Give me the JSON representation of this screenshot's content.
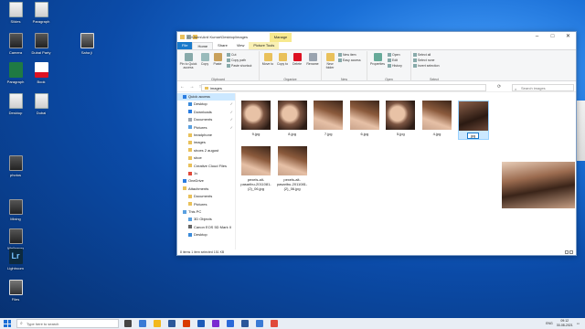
{
  "desktop": {
    "icons": [
      {
        "label": "Sildes",
        "kind": "doc"
      },
      {
        "label": "Paragraph",
        "kind": "doc"
      },
      {
        "label": "Camera",
        "kind": "exe"
      },
      {
        "label": "Dubai Party",
        "kind": "exe"
      },
      {
        "label": "Saha ji",
        "kind": "photo"
      },
      {
        "label": "Paragraph",
        "kind": "xls"
      },
      {
        "label": "Book",
        "kind": "pdf"
      },
      {
        "label": "Desktop",
        "kind": "doc"
      },
      {
        "label": "Dubai",
        "kind": "doc"
      },
      {
        "label": "photos",
        "kind": "exe"
      },
      {
        "label": "Mixing",
        "kind": "exe"
      },
      {
        "label": "Wallpaper",
        "kind": "exe"
      },
      {
        "label": "Lightroom",
        "kind": "lr"
      },
      {
        "label": "Files",
        "kind": "photo"
      }
    ]
  },
  "explorer": {
    "title": "C:\\Users\\Anil Kumar\\Desktop\\images",
    "manage_label": "Manage",
    "window_buttons": [
      "–",
      "□",
      "✕"
    ],
    "tabs": [
      "File",
      "Home",
      "Share",
      "View",
      "Picture Tools"
    ],
    "ribbon": {
      "clipboard": {
        "name": "Clipboard",
        "pin": "Pin to Quick access",
        "copy": "Copy",
        "paste": "Paste",
        "cut": "Cut",
        "copy_path": "Copy path",
        "paste_shortcut": "Paste shortcut"
      },
      "organize": {
        "name": "Organize",
        "move_to": "Move to",
        "copy_to": "Copy to",
        "delete": "Delete",
        "rename": "Rename"
      },
      "new": {
        "name": "New",
        "new_folder": "New folder",
        "new_item": "New item",
        "easy_access": "Easy access"
      },
      "open": {
        "name": "Open",
        "properties": "Properties",
        "open": "Open",
        "edit": "Edit",
        "history": "History"
      },
      "select": {
        "name": "Select",
        "select_all": "Select all",
        "select_none": "Select none",
        "invert": "Invert selection"
      }
    },
    "address": {
      "nav": "←  →  ↑",
      "path": "images",
      "search_placeholder": "Search images"
    },
    "nav_items": [
      {
        "label": "Quick access",
        "pinned": false,
        "selected": true,
        "color": "#2a7de1"
      },
      {
        "label": "Desktop",
        "pinned": true,
        "selected": false,
        "color": "#3b8ad9"
      },
      {
        "label": "Downloads",
        "pinned": true,
        "selected": false,
        "color": "#2a7de1"
      },
      {
        "label": "Documents",
        "pinned": true,
        "selected": false,
        "color": "#9aa4b0"
      },
      {
        "label": "Pictures",
        "pinned": true,
        "selected": false,
        "color": "#5aa0e0"
      },
      {
        "label": "headphone",
        "pinned": false,
        "selected": false,
        "color": "#e9c15b"
      },
      {
        "label": "images",
        "pinned": false,
        "selected": false,
        "color": "#e9c15b"
      },
      {
        "label": "shoes 2 august",
        "pinned": false,
        "selected": false,
        "color": "#e9c15b"
      },
      {
        "label": "shoe",
        "pinned": false,
        "selected": false,
        "color": "#e9c15b"
      },
      {
        "label": "Creative Cloud Files",
        "pinned": false,
        "selected": false,
        "color": "#e9c15b"
      },
      {
        "label": "1v",
        "pinned": false,
        "selected": false,
        "color": "#e04a3a"
      },
      {
        "label": "OneDrive",
        "pinned": false,
        "selected": false,
        "color": "#2a7de1"
      },
      {
        "label": "Attachments",
        "pinned": false,
        "selected": false,
        "color": "#e9c15b"
      },
      {
        "label": "Documents",
        "pinned": false,
        "selected": false,
        "color": "#e9c15b"
      },
      {
        "label": "Pictures",
        "pinned": false,
        "selected": false,
        "color": "#e9c15b"
      },
      {
        "label": "This PC",
        "pinned": false,
        "selected": false,
        "color": "#5aa0e0"
      },
      {
        "label": "3D Objects",
        "pinned": false,
        "selected": false,
        "color": "#5aa0e0"
      },
      {
        "label": "Canon EOS 5D Mark II",
        "pinned": false,
        "selected": false,
        "color": "#666"
      },
      {
        "label": "Desktop",
        "pinned": false,
        "selected": false,
        "color": "#3b8ad9"
      }
    ],
    "files": [
      {
        "name": "9.jpg",
        "style": "face"
      },
      {
        "name": "8.jpg",
        "style": "face"
      },
      {
        "name": "7.jpg",
        "style": "hair"
      },
      {
        "name": "6.jpg",
        "style": "hair"
      },
      {
        "name": "5.jpg",
        "style": "face"
      },
      {
        "name": "4.jpg",
        "style": "hair"
      },
      {
        "name": "jpg",
        "style": "sel",
        "selected": true
      },
      {
        "name": "pexels-alt-pasaribu-2011081-(2)_06.jpg",
        "style": "hair"
      },
      {
        "name": "pexels-alt-pasaribu-2011081-(2)_06.jpg",
        "style": "hair"
      }
    ],
    "status": "8 items    1 item selected  151 KB"
  },
  "taskbar": {
    "search_placeholder": "Type here to search",
    "time": "09:12",
    "date": "30-08-2021",
    "lang": "ENG",
    "app_colors": [
      "#444",
      "#3a7bd5",
      "#f2b81d",
      "#2b579a",
      "#d83b01",
      "#1e5bb8",
      "#7a2bd1",
      "#2a6ad9",
      "#2b579a",
      "#3a7bd5",
      "#e04a3a"
    ]
  }
}
